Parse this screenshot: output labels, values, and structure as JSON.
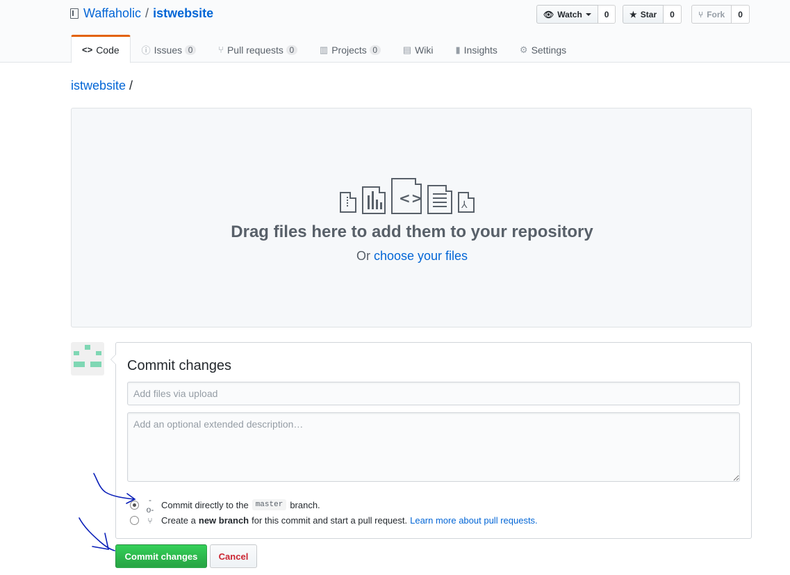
{
  "repo": {
    "owner": "Waffaholic",
    "separator": "/",
    "name": "istwebsite"
  },
  "actions": {
    "watch_label": "Watch",
    "watch_count": "0",
    "star_label": "Star",
    "star_count": "0",
    "fork_label": "Fork",
    "fork_count": "0"
  },
  "tabs": [
    {
      "label": "Code",
      "icon": "code-icon"
    },
    {
      "label": "Issues",
      "icon": "issue-icon",
      "count": "0"
    },
    {
      "label": "Pull requests",
      "icon": "pull-request-icon",
      "count": "0"
    },
    {
      "label": "Projects",
      "icon": "project-icon",
      "count": "0"
    },
    {
      "label": "Wiki",
      "icon": "book-icon"
    },
    {
      "label": "Insights",
      "icon": "graph-icon"
    },
    {
      "label": "Settings",
      "icon": "gear-icon"
    }
  ],
  "breadcrumb": {
    "repo": "istwebsite",
    "slash": "/"
  },
  "dropzone": {
    "title": "Drag files here to add them to your repository",
    "or_text": "Or",
    "choose_link": "choose your files"
  },
  "commit": {
    "title": "Commit changes",
    "summary_placeholder": "Add files via upload",
    "description_placeholder": "Add an optional extended description…",
    "option_direct_prefix": "Commit directly to the",
    "branch": "master",
    "option_direct_suffix": "branch.",
    "option_new_prefix": "Create a",
    "option_new_bold": "new branch",
    "option_new_suffix": "for this commit and start a pull request.",
    "option_new_link": "Learn more about pull requests.",
    "commit_button": "Commit changes",
    "cancel_button": "Cancel"
  },
  "colors": {
    "link": "#0366d6",
    "primary_button": "#28a745",
    "cancel_text": "#cb2431",
    "selected_tab_accent": "#e36209",
    "annotation_ink": "#0a1fb8"
  }
}
